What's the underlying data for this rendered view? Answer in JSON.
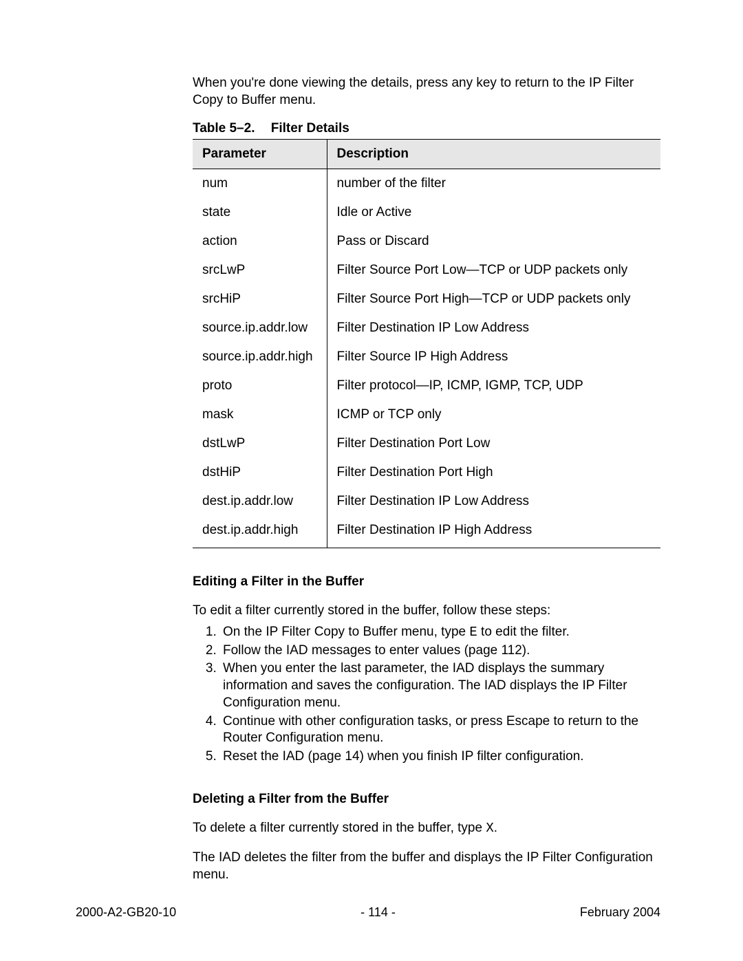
{
  "intro": "When you're done viewing the details, press any key to return to the IP Filter Copy to Buffer menu.",
  "table": {
    "caption_number": "Table 5–2.",
    "caption_title": "Filter Details",
    "headers": {
      "param": "Parameter",
      "desc": "Description"
    },
    "rows": [
      {
        "param": "num",
        "desc": "number of the filter"
      },
      {
        "param": "state",
        "desc": "Idle or Active"
      },
      {
        "param": "action",
        "desc": "Pass or Discard"
      },
      {
        "param": "srcLwP",
        "desc": "Filter Source Port Low—TCP or UDP packets only"
      },
      {
        "param": "srcHiP",
        "desc": "Filter Source Port High—TCP or UDP packets only"
      },
      {
        "param": "source.ip.addr.low",
        "desc": "Filter Destination IP Low Address"
      },
      {
        "param": "source.ip.addr.high",
        "desc": "Filter Source IP High Address"
      },
      {
        "param": "proto",
        "desc": "Filter protocol—IP, ICMP, IGMP, TCP, UDP"
      },
      {
        "param": "mask",
        "desc": "ICMP or TCP only"
      },
      {
        "param": "dstLwP",
        "desc": "Filter Destination Port Low"
      },
      {
        "param": "dstHiP",
        "desc": "Filter Destination Port High"
      },
      {
        "param": "dest.ip.addr.low",
        "desc": "Filter Destination IP Low Address"
      },
      {
        "param": "dest.ip.addr.high",
        "desc": "Filter Destination IP High Address"
      }
    ]
  },
  "section_edit": {
    "heading": "Editing a Filter in the Buffer",
    "lead": "To edit a filter currently stored in the buffer, follow these steps:",
    "steps": [
      {
        "pre": "On the IP Filter Copy to Buffer menu, type ",
        "code": "E",
        "post": " to edit the filter."
      },
      {
        "pre": "Follow the IAD messages to enter values (page 112).",
        "code": "",
        "post": ""
      },
      {
        "pre": "When you enter the last parameter, the IAD displays the summary information and saves the configuration. The IAD displays the IP Filter Configuration menu.",
        "code": "",
        "post": ""
      },
      {
        "pre": "Continue with other configuration tasks, or press Escape to return to the Router Configuration menu.",
        "code": "",
        "post": ""
      },
      {
        "pre": "Reset the IAD (page 14) when you finish IP filter configuration.",
        "code": "",
        "post": ""
      }
    ]
  },
  "section_delete": {
    "heading": "Deleting a Filter from the Buffer",
    "lead_pre": "To delete a filter currently stored in the buffer, type ",
    "lead_code": "X",
    "lead_post": ".",
    "body": "The IAD deletes the filter from the buffer and displays the IP Filter Configuration menu."
  },
  "footer": {
    "doc_id": "2000-A2-GB20-10",
    "page": "- 114 -",
    "date": "February 2004"
  }
}
